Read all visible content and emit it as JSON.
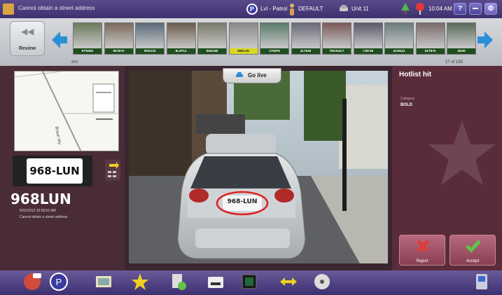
{
  "titlebar": {
    "title": "Cannot obtain a street address",
    "patrol_icon_glyph": "P",
    "patrol_label": "Lvl - Patrol",
    "user_label": "DEFAULT",
    "unit_label": "Unit 11",
    "clock": "10:04 AM",
    "help_glyph": "?"
  },
  "strip": {
    "review_label": "Review",
    "date_label": "9/31",
    "count_label": "17 of 193",
    "thumbnails": [
      {
        "plate": "ETN482"
      },
      {
        "plate": "8K3575"
      },
      {
        "plate": "9KE218"
      },
      {
        "plate": "9L2P14"
      },
      {
        "plate": "9681DB"
      },
      {
        "plate": "968LUN",
        "selected": true
      },
      {
        "plate": "1T82P5"
      },
      {
        "plate": "4LY648"
      },
      {
        "plate": "7MCN4C7"
      },
      {
        "plate": "7J8748"
      },
      {
        "plate": "4CM441"
      },
      {
        "plate": "5ZT875"
      },
      {
        "plate": "3EH9"
      }
    ]
  },
  "map": {
    "street_label": "Braun Wy"
  },
  "plate": {
    "crop_text": "968-LUN",
    "number": "968LUN",
    "timestamp": "5/31/2013 10:09:51 AM",
    "address": "Cannot obtain a street address",
    "scene_plate_text": "968-LUN"
  },
  "golive": {
    "label": "Go live"
  },
  "hotlist": {
    "title": "Hotlist hit",
    "category_label": "Category",
    "category_value": "BOLD"
  },
  "actions": {
    "reject_label": "Reject",
    "accept_label": "Accept"
  },
  "colors": {
    "titlebar": "#4a3d80",
    "panel": "#4a2c36",
    "hotlist_panel": "#5a2c3a",
    "selected_thumb": "#d8d820",
    "arrow_blue": "#2b8fd8",
    "accept_green": "#5fc34b",
    "reject_red": "#e23a3a"
  },
  "toolbar_icons": [
    "alert-bell-icon",
    "patrol-p-icon",
    "tool-3-icon",
    "tool-4-icon",
    "tool-5-icon",
    "tool-6-icon",
    "tool-7-icon",
    "tool-8-icon",
    "tool-9-icon",
    "tool-10-icon"
  ]
}
